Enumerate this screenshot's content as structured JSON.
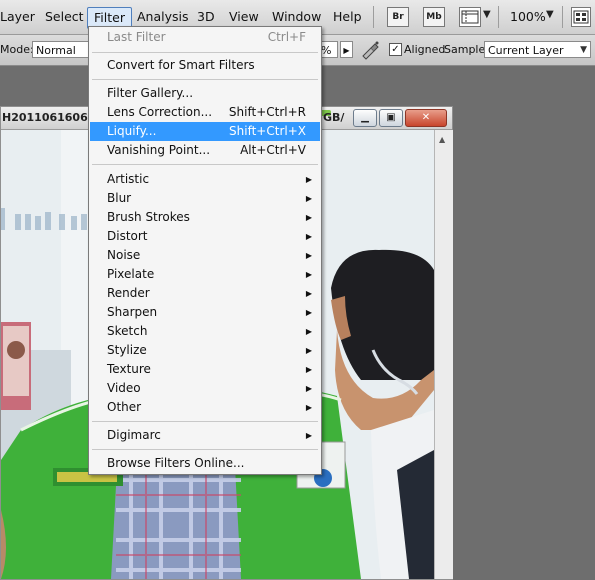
{
  "menubar": {
    "items": [
      "Layer",
      "Select",
      "Filter",
      "Analysis",
      "3D",
      "View",
      "Window",
      "Help"
    ],
    "bridge_label": "Br",
    "minibridge_label": "Mb",
    "zoom": "100%"
  },
  "optbar": {
    "mode_label": "Mode:",
    "mode_value": "Normal",
    "opacity_partial": "%",
    "aligned_label": "Aligned",
    "aligned_checked": true,
    "sample_label": "Sample:",
    "sample_value": "Current Layer"
  },
  "document": {
    "title": "H2011061606510",
    "title_suffix": "GB/"
  },
  "filter_menu": {
    "items": [
      {
        "label": "Last Filter",
        "shortcut": "Ctrl+F",
        "disabled": true
      },
      {
        "label": "Convert for Smart Filters",
        "shortcut": ""
      },
      {
        "label": "Filter Gallery...",
        "shortcut": ""
      },
      {
        "label": "Lens Correction...",
        "shortcut": "Shift+Ctrl+R"
      },
      {
        "label": "Liquify...",
        "shortcut": "Shift+Ctrl+X",
        "highlighted": true
      },
      {
        "label": "Vanishing Point...",
        "shortcut": "Alt+Ctrl+V"
      },
      {
        "label": "Artistic",
        "submenu": true
      },
      {
        "label": "Blur",
        "submenu": true
      },
      {
        "label": "Brush Strokes",
        "submenu": true
      },
      {
        "label": "Distort",
        "submenu": true
      },
      {
        "label": "Noise",
        "submenu": true
      },
      {
        "label": "Pixelate",
        "submenu": true
      },
      {
        "label": "Render",
        "submenu": true
      },
      {
        "label": "Sharpen",
        "submenu": true
      },
      {
        "label": "Sketch",
        "submenu": true
      },
      {
        "label": "Stylize",
        "submenu": true
      },
      {
        "label": "Texture",
        "submenu": true
      },
      {
        "label": "Video",
        "submenu": true
      },
      {
        "label": "Other",
        "submenu": true
      },
      {
        "label": "Digimarc",
        "submenu": true
      },
      {
        "label": "Browse Filters Online...",
        "shortcut": ""
      }
    ]
  },
  "colors": {
    "highlight": "#3399ff",
    "vest_green": "#3fb13a",
    "app_background": "#6e6e6e"
  }
}
